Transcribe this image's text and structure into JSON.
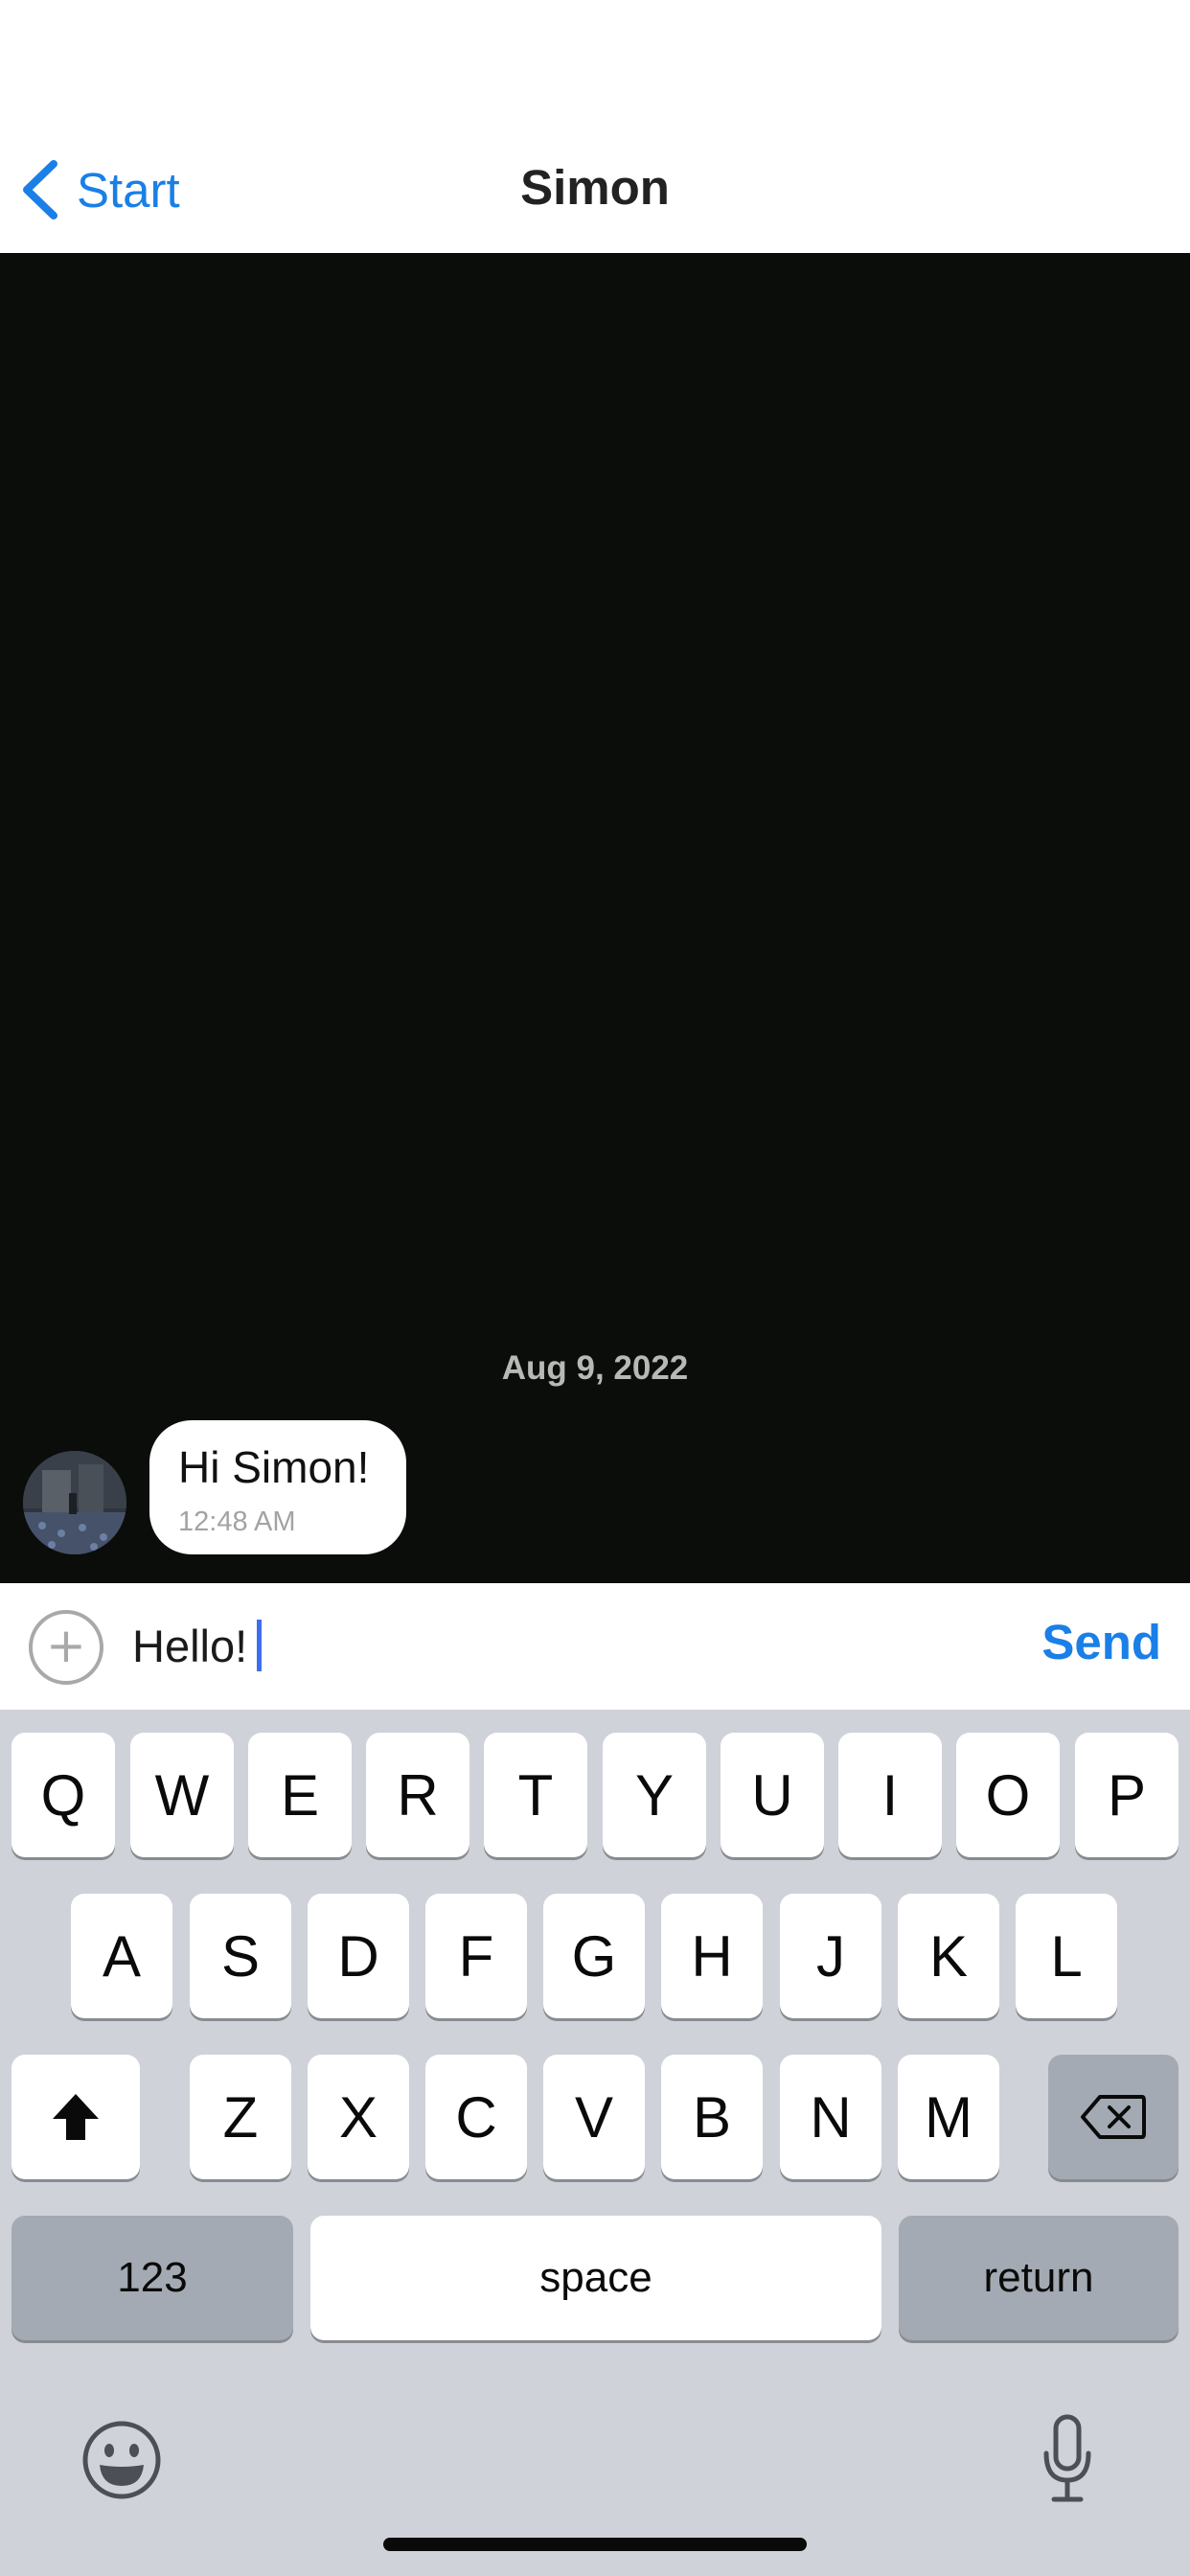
{
  "nav": {
    "back_label": "Start",
    "title": "Simon"
  },
  "chat": {
    "date_separator": "Aug 9, 2022",
    "messages": [
      {
        "text": "Hi Simon!",
        "time": "12:48 AM",
        "direction": "incoming"
      }
    ]
  },
  "composer": {
    "attach_icon": "plus-circle-icon",
    "value": "Hello!",
    "send_label": "Send"
  },
  "keyboard": {
    "row1": [
      "Q",
      "W",
      "E",
      "R",
      "T",
      "Y",
      "U",
      "I",
      "O",
      "P"
    ],
    "row2": [
      "A",
      "S",
      "D",
      "F",
      "G",
      "H",
      "J",
      "K",
      "L"
    ],
    "row3": [
      "Z",
      "X",
      "C",
      "V",
      "B",
      "N",
      "M"
    ],
    "shift_icon": "shift-arrow-icon",
    "delete_icon": "delete-backspace-icon",
    "numbers_label": "123",
    "space_label": "space",
    "return_label": "return",
    "emoji_icon": "emoji-icon",
    "mic_icon": "microphone-icon"
  },
  "colors": {
    "accent": "#1a7fe6",
    "chat_background": "#0b0d0b",
    "keyboard_background": "#cfd2d8",
    "caret": "#3e6ef0"
  }
}
